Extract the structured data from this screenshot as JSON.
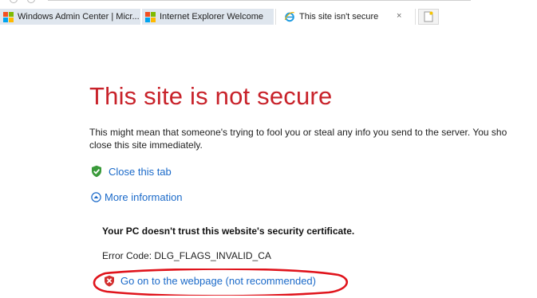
{
  "browser": {
    "tabs": [
      {
        "title": "Windows Admin Center | Micr...",
        "icon": "windows-logo-icon",
        "active": false
      },
      {
        "title": "Internet Explorer Welcome",
        "icon": "windows-logo-icon",
        "active": false
      },
      {
        "title": "This site isn't secure",
        "icon": "internet-explorer-icon",
        "active": true,
        "close_glyph": "×"
      }
    ],
    "new_tab_icon": "new-tab-icon"
  },
  "page": {
    "title": "This site is not secure",
    "warning_line_1": "This might mean that someone's trying to fool you or steal any info you send to the server. You sho",
    "warning_line_2": "close this site immediately.",
    "close_tab_link": "Close this tab",
    "close_tab_icon": "green-shield-check-icon",
    "more_info_link": "More information",
    "more_info_icon": "circle-chevron-up-icon",
    "cert_heading": "Your PC doesn't trust this website's security certificate.",
    "error_code": "Error Code: DLG_FLAGS_INVALID_CA",
    "go_on_link": "Go on to the webpage (not recommended)",
    "go_on_icon": "red-shield-x-icon"
  },
  "annotation": {
    "shape": "ellipse",
    "color": "#e0141c"
  },
  "colors": {
    "title_red": "#c8222a",
    "link_blue": "#1b6ac9"
  }
}
